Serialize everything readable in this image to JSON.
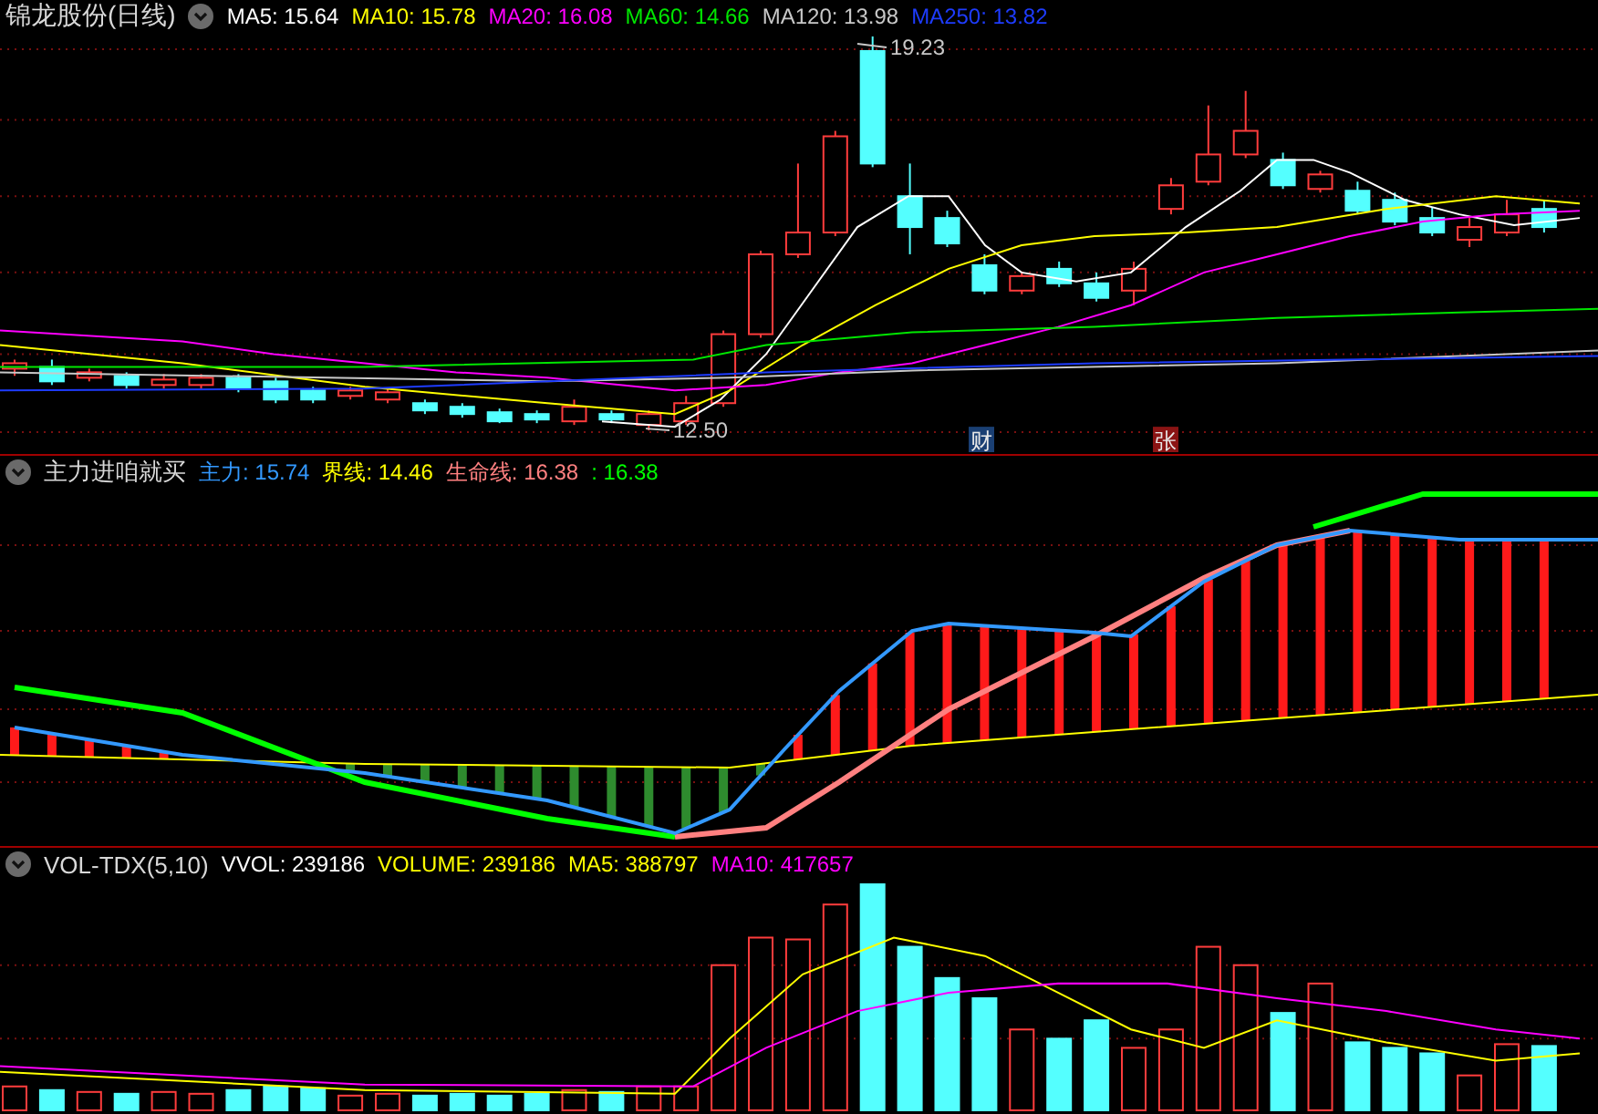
{
  "main_panel": {
    "title": "锦龙股份(日线)",
    "indicators": [
      {
        "label": "MA5: 15.64",
        "color": "#ffffff"
      },
      {
        "label": "MA10: 15.78",
        "color": "#ffff00"
      },
      {
        "label": "MA20: 16.08",
        "color": "#ff00ff"
      },
      {
        "label": "MA60: 14.66",
        "color": "#00e600"
      },
      {
        "label": "MA120: 13.98",
        "color": "#c8c8c8"
      },
      {
        "label": "MA250: 13.82",
        "color": "#1e3cff"
      }
    ],
    "high_label": "19.23",
    "low_label": "12.50",
    "badges": [
      {
        "text": "财",
        "color": "#1a3f73"
      },
      {
        "text": "张",
        "color": "#8a1414"
      }
    ]
  },
  "signal_panel": {
    "title": "主力进咱就买",
    "indicators": [
      {
        "label": "主力: 15.74",
        "color": "#3399ff"
      },
      {
        "label": "界线: 14.46",
        "color": "#ffff00"
      },
      {
        "label": "生命线: 16.38",
        "color": "#ff8080"
      },
      {
        "label": ": 16.38",
        "color": "#00ff00"
      }
    ]
  },
  "volume_panel": {
    "title": "VOL-TDX(5,10)",
    "indicators": [
      {
        "label": "VVOL: 239186",
        "color": "#ffffff"
      },
      {
        "label": "VOLUME: 239186",
        "color": "#ffff00"
      },
      {
        "label": "MA5: 388797",
        "color": "#ffff00"
      },
      {
        "label": "MA10: 417657",
        "color": "#ff00ff"
      }
    ]
  }
}
